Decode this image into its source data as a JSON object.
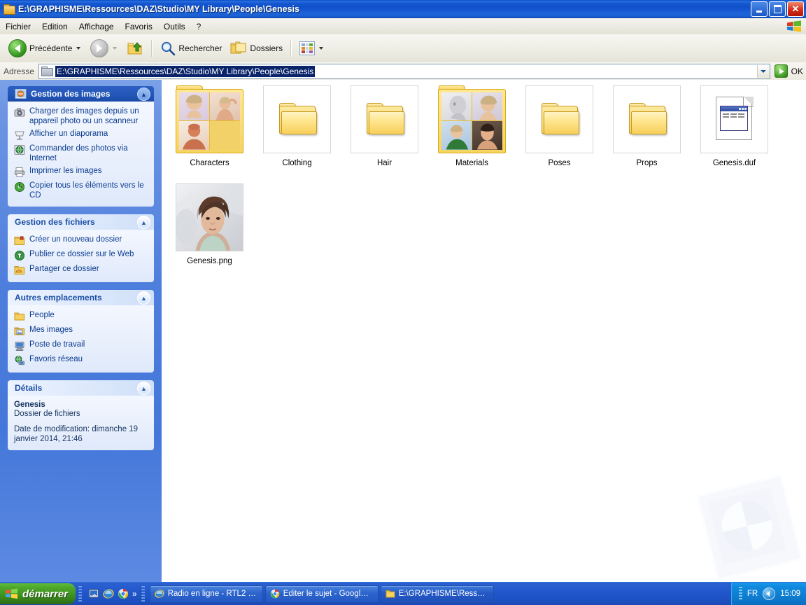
{
  "window": {
    "title": "E:\\GRAPHISME\\Ressources\\DAZ\\Studio\\MY Library\\People\\Genesis",
    "icon": "folder-icon",
    "controls": {
      "minimize": "_",
      "maximize": "❐",
      "close": "✕"
    }
  },
  "menubar": {
    "items": [
      {
        "label": "Fichier"
      },
      {
        "label": "Edition"
      },
      {
        "label": "Affichage"
      },
      {
        "label": "Favoris"
      },
      {
        "label": "Outils"
      },
      {
        "label": "?"
      }
    ],
    "logo": "windows-flag-icon"
  },
  "toolbar": {
    "back": {
      "label": "Précédente",
      "icon": "back-arrow-icon"
    },
    "forward": {
      "label": "",
      "icon": "forward-arrow-icon"
    },
    "up": {
      "label": "",
      "icon": "up-folder-icon"
    },
    "search": {
      "label": "Rechercher",
      "icon": "search-icon"
    },
    "folders": {
      "label": "Dossiers",
      "icon": "folders-icon"
    },
    "views": {
      "label": "",
      "icon": "views-icon"
    }
  },
  "address": {
    "label": "Adresse",
    "value": "E:\\GRAPHISME\\Ressources\\DAZ\\Studio\\MY Library\\People\\Genesis",
    "icon": "folder-icon",
    "go_label": "OK",
    "dropdown_icon": "chevron-down-icon"
  },
  "sidebar": {
    "panels": [
      {
        "title": "Gestion des images",
        "style": "dark",
        "icon": "picture-tasks-icon",
        "collapse_icon": "chevron-up-icon",
        "items": [
          {
            "label": "Charger des images depuis un appareil photo ou un scanneur",
            "icon": "camera-icon"
          },
          {
            "label": "Afficher un diaporama",
            "icon": "slideshow-icon"
          },
          {
            "label": "Commander des photos via Internet",
            "icon": "globe-icon"
          },
          {
            "label": "Imprimer les images",
            "icon": "printer-icon"
          },
          {
            "label": "Copier tous les éléments vers le CD",
            "icon": "cd-burn-icon"
          }
        ]
      },
      {
        "title": "Gestion des fichiers",
        "style": "light",
        "collapse_icon": "chevron-up-icon",
        "items": [
          {
            "label": "Créer un nouveau dossier",
            "icon": "new-folder-icon"
          },
          {
            "label": "Publier ce dossier sur le Web",
            "icon": "publish-web-icon"
          },
          {
            "label": "Partager ce dossier",
            "icon": "share-folder-icon"
          }
        ]
      },
      {
        "title": "Autres emplacements",
        "style": "light",
        "collapse_icon": "chevron-up-icon",
        "items": [
          {
            "label": "People",
            "icon": "folder-icon"
          },
          {
            "label": "Mes images",
            "icon": "my-pictures-icon"
          },
          {
            "label": "Poste de travail",
            "icon": "my-computer-icon"
          },
          {
            "label": "Favoris réseau",
            "icon": "network-icon"
          }
        ]
      },
      {
        "title": "Détails",
        "style": "light",
        "collapse_icon": "chevron-up-icon",
        "details": {
          "name": "Genesis",
          "type": "Dossier de fichiers",
          "modified": "Date de modification: dimanche 19 janvier 2014, 21:46"
        }
      }
    ]
  },
  "files": {
    "items": [
      {
        "label": "Characters",
        "kind": "folder-thumbs",
        "icon": "folder-with-previews-icon"
      },
      {
        "label": "Clothing",
        "kind": "folder-empty",
        "icon": "folder-icon"
      },
      {
        "label": "Hair",
        "kind": "folder-empty",
        "icon": "folder-icon"
      },
      {
        "label": "Materials",
        "kind": "folder-thumbs",
        "icon": "folder-with-previews-icon"
      },
      {
        "label": "Poses",
        "kind": "folder-empty",
        "icon": "folder-icon"
      },
      {
        "label": "Props",
        "kind": "folder-empty",
        "icon": "folder-icon"
      },
      {
        "label": "Genesis.duf",
        "kind": "document",
        "icon": "duf-document-icon"
      },
      {
        "label": "Genesis.png",
        "kind": "image",
        "icon": "image-thumbnail-icon"
      }
    ],
    "watermark_icon": "picture-folder-watermark"
  },
  "taskbar": {
    "start_label": "démarrer",
    "start_icon": "windows-flag-icon",
    "quicklaunch": [
      {
        "icon": "show-desktop-icon"
      },
      {
        "icon": "internet-explorer-icon"
      },
      {
        "icon": "chrome-icon"
      },
      {
        "icon": "chevron-right-icon"
      }
    ],
    "windows": [
      {
        "label": "Radio en ligne - RTL2 …",
        "icon": "internet-explorer-icon"
      },
      {
        "label": "Editer le sujet - Googl…",
        "icon": "chrome-icon"
      },
      {
        "label": "E:\\GRAPHISME\\Ress…",
        "icon": "folder-icon"
      }
    ],
    "tray": {
      "language": "FR",
      "icon": "volume-icon",
      "clock": "15:09"
    }
  },
  "colors": {
    "title_blue": "#1050cc",
    "sidebar_blue": "#4f7fdd",
    "panel_header_dark": "#2458b9",
    "link_blue": "#0b3c8f",
    "start_green": "#3f9420",
    "selection_blue": "#0a246a"
  }
}
